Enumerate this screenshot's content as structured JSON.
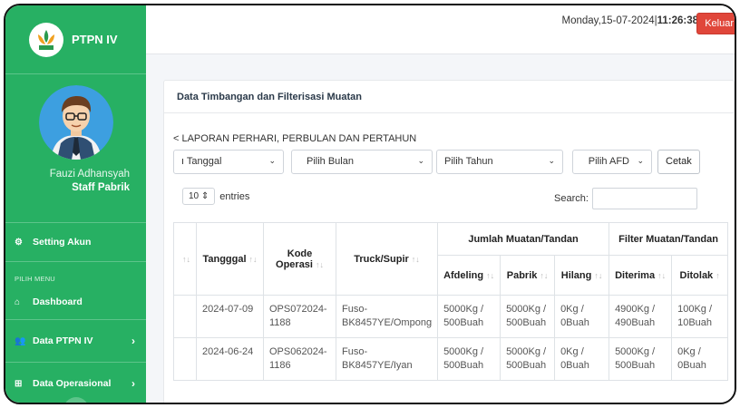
{
  "sidebar": {
    "brand": "PTPN IV",
    "user_name": "Fauzi Adhansyah",
    "user_role": "Staff Pabrik",
    "setting_label": "Setting Akun",
    "menu_header": "PILIH MENU",
    "items": [
      {
        "label": "Dashboard",
        "icon": "home-icon"
      },
      {
        "label": "Data PTPN IV",
        "icon": "users-icon",
        "has_children": true
      },
      {
        "label": "Data Operasional",
        "icon": "sitemap-icon",
        "has_children": true
      }
    ]
  },
  "topbar": {
    "date": "Monday,15-07-2024|",
    "time": "11:26:38",
    "logout": "Keluar"
  },
  "card": {
    "title": "Data Timbangan dan Filterisasi Muatan",
    "report_title": "< LAPORAN PERHARI, PERBULAN DAN PERTAHUN",
    "filters": {
      "tanggal": "ı Tanggal",
      "bulan": "Pilih Bulan",
      "tahun": "Pilih Tahun",
      "afd": "Pilih AFD",
      "cetak": "Cetak"
    },
    "entries_value": "10",
    "entries_label": "entries",
    "search_label": "Search:"
  },
  "table": {
    "group_headers": [
      "Jumlah Muatan/Tandan",
      "Filter Muatan/Tandan"
    ],
    "columns": [
      "Tangggal",
      "Kode Operasi",
      "Truck/Supir",
      "Afdeling",
      "Pabrik",
      "Hilang",
      "Diterima",
      "Ditolak"
    ],
    "rows": [
      {
        "tanggal": "2024-07-09",
        "kode": "OPS072024-1188",
        "truck": "Fuso-BK8457YE/Ompong",
        "afdeling": "5000Kg / 500Buah",
        "pabrik": "5000Kg / 500Buah",
        "hilang": "0Kg / 0Buah",
        "diterima": "4900Kg / 490Buah",
        "ditolak": "100Kg / 10Buah"
      },
      {
        "tanggal": "2024-06-24",
        "kode": "OPS062024-1186",
        "truck": "Fuso-BK8457YE/Iyan",
        "afdeling": "5000Kg / 500Buah",
        "pabrik": "5000Kg / 500Buah",
        "hilang": "0Kg / 0Buah",
        "diterima": "5000Kg / 500Buah",
        "ditolak": "0Kg / 0Buah"
      }
    ]
  },
  "colors": {
    "sidebar": "#27b063",
    "logout": "#e0463a"
  }
}
